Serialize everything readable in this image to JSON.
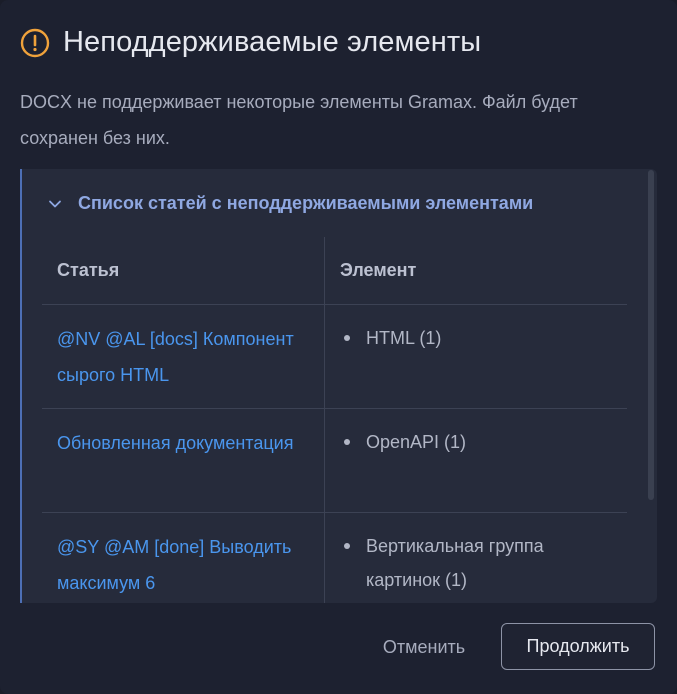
{
  "dialog": {
    "title": "Неподдерживаемые элементы",
    "description": "DOCX не поддерживает некоторые элементы Gramax. Файл будет сохранен без них.",
    "icon": "warning-icon"
  },
  "details": {
    "summary": "Список статей с неподдерживаемыми элементами",
    "expanded": true,
    "columns": [
      "Статья",
      "Элемент"
    ],
    "rows": [
      {
        "article": "@NV @AL [docs] Компонент сырого HTML",
        "element": "HTML (1)"
      },
      {
        "article": "Обновленная документация",
        "element": "OpenAPI (1)"
      },
      {
        "article": "@SY @AM [done] Выводить максимум 6",
        "element": "Вертикальная группа картинок (1)"
      }
    ]
  },
  "buttons": {
    "cancel": "Отменить",
    "continue": "Продолжить"
  },
  "colors": {
    "background": "#1d2130",
    "panel": "#262b3b",
    "accent_warning": "#f0a23b",
    "link": "#4a96ee",
    "summary": "#8fa8e2"
  }
}
